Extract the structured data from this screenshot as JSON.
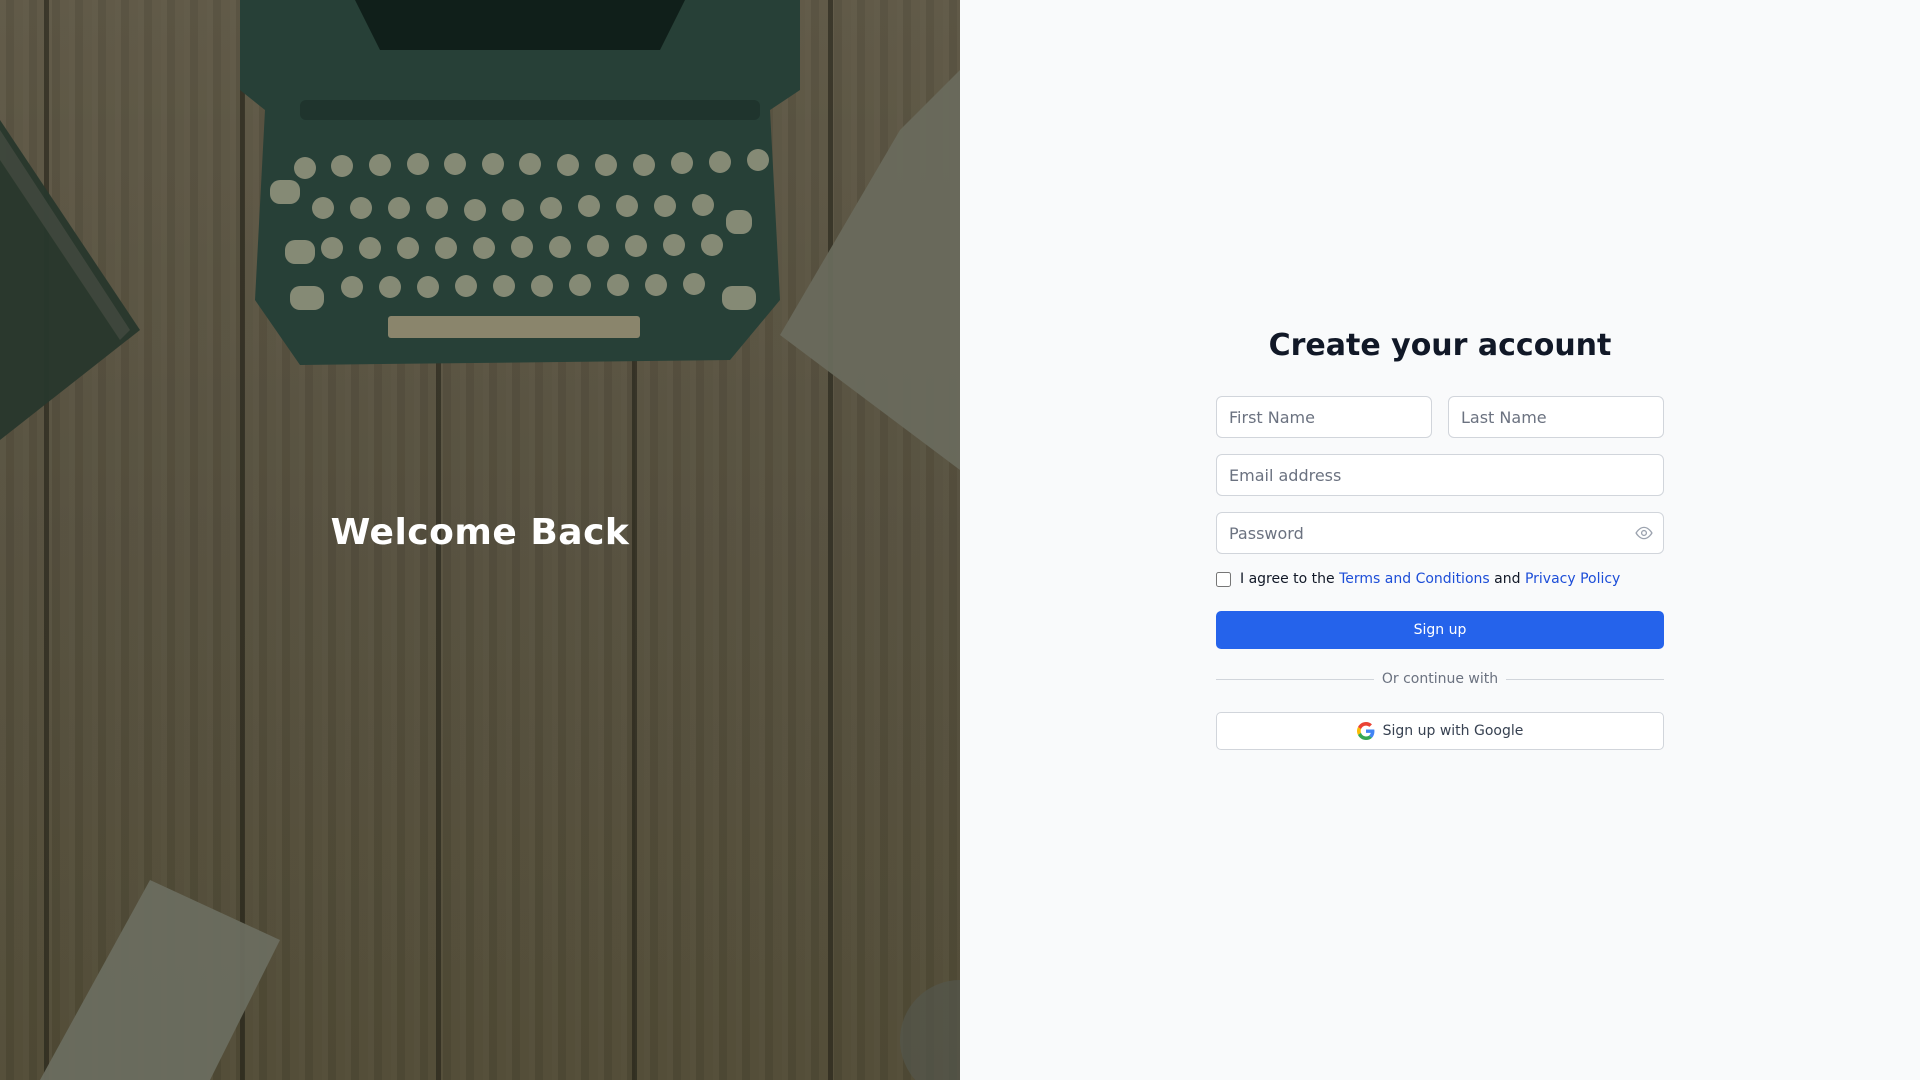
{
  "hero": {
    "title": "Welcome Back"
  },
  "form": {
    "title": "Create your account",
    "first_name": {
      "placeholder": "First Name",
      "value": ""
    },
    "last_name": {
      "placeholder": "Last Name",
      "value": ""
    },
    "email": {
      "placeholder": "Email address",
      "value": ""
    },
    "password": {
      "placeholder": "Password",
      "value": ""
    },
    "agree": {
      "checked": false,
      "prefix": "I agree to the ",
      "terms_link": "Terms and Conditions",
      "middle": " and ",
      "privacy_link": "Privacy Policy"
    },
    "signup_label": "Sign up",
    "divider_label": "Or continue with",
    "google_label": "Sign up with Google"
  },
  "icons": {
    "password_toggle": "eye-icon",
    "google": "google-icon"
  },
  "colors": {
    "primary": "#2563eb",
    "link": "#1d4ed8",
    "title": "#111827",
    "muted": "#6b7280",
    "panel_bg": "#f9fafb"
  }
}
